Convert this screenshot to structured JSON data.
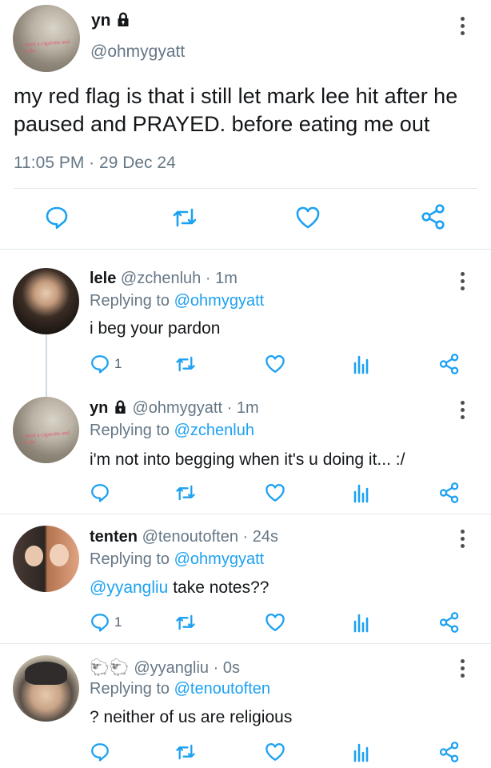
{
  "main_tweet": {
    "name": "yn",
    "handle": "@ohmygyatt",
    "avatar_caption": "i need a cigarette and to die",
    "text": "my red flag is that i still let mark lee hit after he paused and PRAYED. before eating me out",
    "time": "11:05 PM",
    "sep": "·",
    "date": "29 Dec 24",
    "icons": [
      "reply-icon",
      "retweet-icon",
      "like-icon",
      "share-icon"
    ]
  },
  "replies": [
    {
      "name": "lele",
      "handle": "@zchenluh",
      "time": "· 1m",
      "replying_prefix": "Replying to",
      "replying_to": "@ohmygyatt",
      "text": "i beg your pardon",
      "reply_count": "1"
    },
    {
      "name": "yn",
      "handle": "@ohmygyatt",
      "time": "· 1m",
      "replying_prefix": "Replying to",
      "replying_to": "@zchenluh",
      "text": "i'm not into begging when it's u doing it... :/",
      "reply_count": ""
    },
    {
      "name": "tenten",
      "handle": "@tenoutoften",
      "time": "· 24s",
      "replying_prefix": "Replying to",
      "replying_to": "@ohmygyatt",
      "mention": "@yyangliu",
      "text": " take notes??",
      "reply_count": "1"
    },
    {
      "name": "🐑🐑",
      "handle": "@yyangliu",
      "time": "· 0s",
      "replying_prefix": "Replying to",
      "replying_to": "@tenoutoften",
      "text": "? neither of us are religious",
      "reply_count": ""
    }
  ],
  "colors": {
    "link": "#1da1f2",
    "muted": "#657786",
    "icon": "#1da1f2",
    "divider": "#e1e8ed"
  }
}
